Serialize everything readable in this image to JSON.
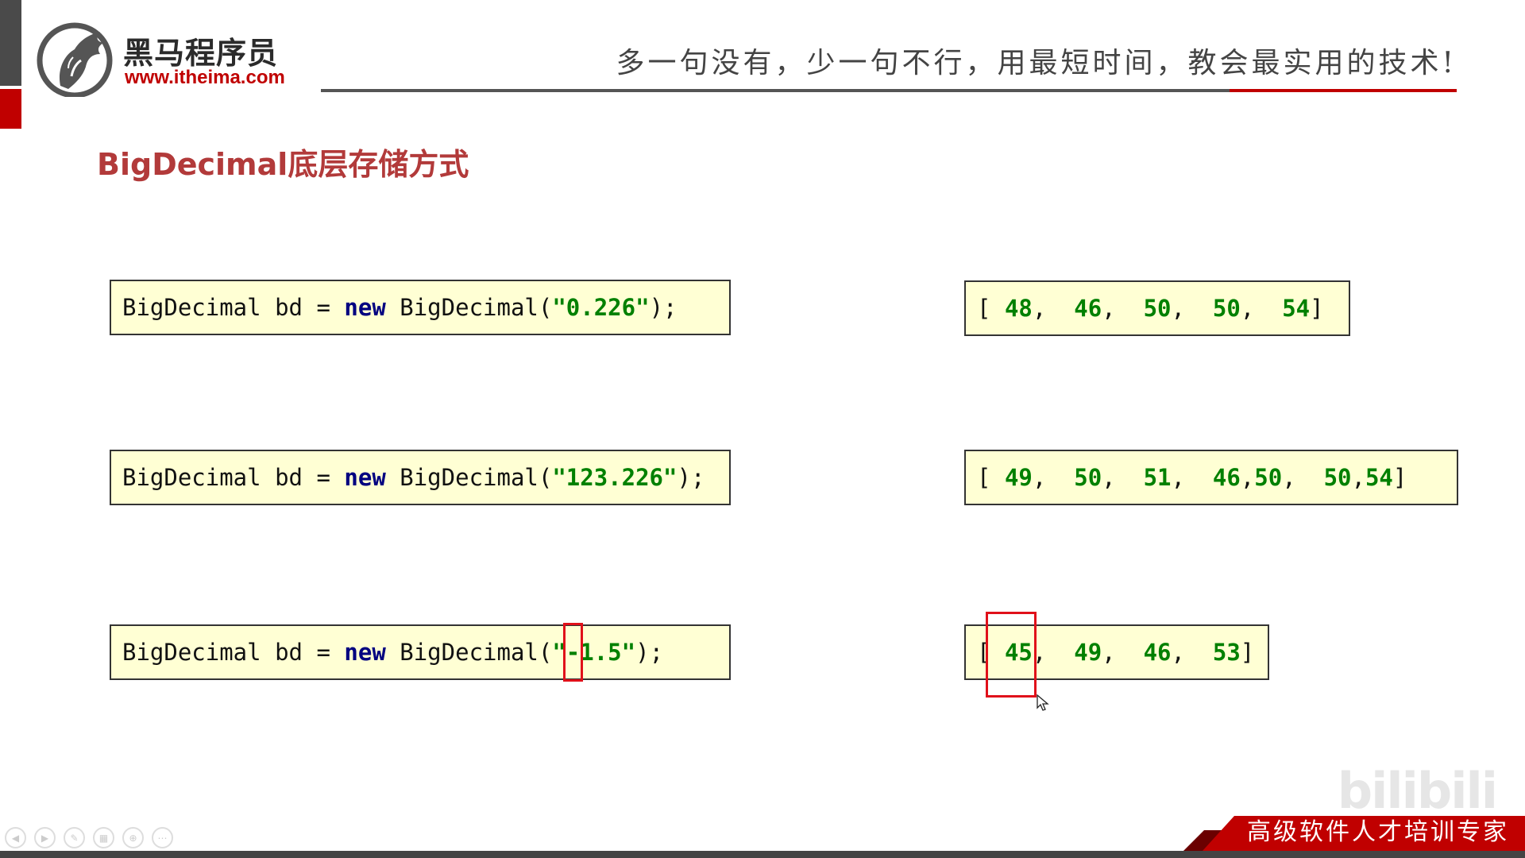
{
  "header": {
    "brand_name": "黑马程序员",
    "brand_url": "www.itheima.com",
    "slogan": "多一句没有，少一句不行，用最短时间，教会最实用的技术!"
  },
  "slide": {
    "title": "BigDecimal底层存储方式"
  },
  "examples": [
    {
      "code": {
        "type": "BigDecimal",
        "var": "bd",
        "eq": "=",
        "kw_new": "new",
        "ctor": "BigDecimal(",
        "quote_open": "\"",
        "arg": "0.226",
        "quote_close": "\"",
        "tail": ");"
      },
      "array": {
        "open": "[",
        "values": [
          "48",
          "46",
          "50",
          "50",
          "54"
        ],
        "close": "]"
      }
    },
    {
      "code": {
        "type": "BigDecimal",
        "var": "bd",
        "eq": "=",
        "kw_new": "new",
        "ctor": "BigDecimal(",
        "quote_open": "\"",
        "arg": "123.226",
        "quote_close": "\"",
        "tail": ");"
      },
      "array": {
        "open": "[",
        "values": [
          "49",
          "50",
          "51",
          "46",
          "50",
          "50",
          "54"
        ],
        "close": "]"
      }
    },
    {
      "code": {
        "type": "BigDecimal",
        "var": "bd",
        "eq": "=",
        "kw_new": "new",
        "ctor": "BigDecimal(",
        "quote_open": "\"",
        "arg_sign": "-",
        "arg": "1.5",
        "quote_close": "\"",
        "tail": ");"
      },
      "array": {
        "open": "[",
        "values": [
          "45",
          "49",
          "46",
          "53"
        ],
        "close": "]"
      }
    }
  ],
  "footer": {
    "tagline": "高级软件人才培训专家",
    "watermark": "bilibili"
  },
  "colors": {
    "accent_red": "#c00000",
    "title_red": "#b23a3a",
    "code_bg": "#ffffd4",
    "keyword": "#000080",
    "string": "#008000",
    "highlight": "#e0101a"
  },
  "icons": {
    "logo": "horse-head-logo-icon",
    "cursor": "mouse-pointer-icon",
    "player": [
      "prev-icon",
      "next-icon",
      "pen-icon",
      "grid-icon",
      "zoom-icon",
      "more-icon"
    ]
  }
}
